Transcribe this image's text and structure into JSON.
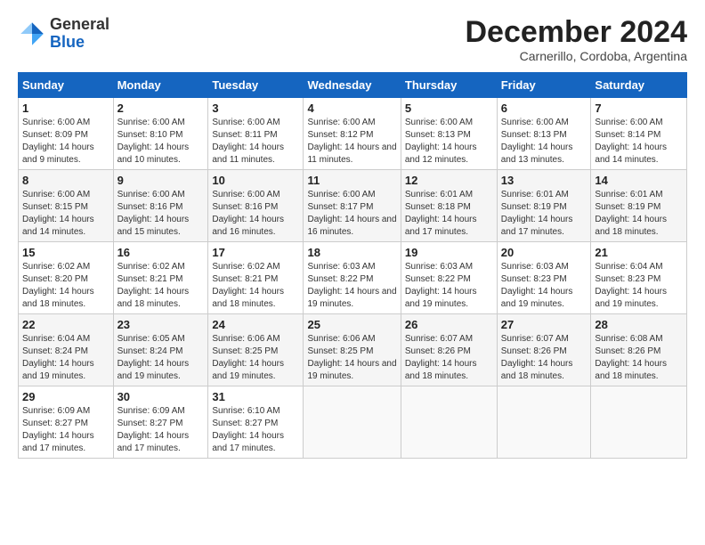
{
  "logo": {
    "general": "General",
    "blue": "Blue"
  },
  "title": "December 2024",
  "subtitle": "Carnerillo, Cordoba, Argentina",
  "days_header": [
    "Sunday",
    "Monday",
    "Tuesday",
    "Wednesday",
    "Thursday",
    "Friday",
    "Saturday"
  ],
  "weeks": [
    [
      {
        "day": "1",
        "sunrise": "6:00 AM",
        "sunset": "8:09 PM",
        "daylight": "14 hours and 9 minutes."
      },
      {
        "day": "2",
        "sunrise": "6:00 AM",
        "sunset": "8:10 PM",
        "daylight": "14 hours and 10 minutes."
      },
      {
        "day": "3",
        "sunrise": "6:00 AM",
        "sunset": "8:11 PM",
        "daylight": "14 hours and 11 minutes."
      },
      {
        "day": "4",
        "sunrise": "6:00 AM",
        "sunset": "8:12 PM",
        "daylight": "14 hours and 11 minutes."
      },
      {
        "day": "5",
        "sunrise": "6:00 AM",
        "sunset": "8:13 PM",
        "daylight": "14 hours and 12 minutes."
      },
      {
        "day": "6",
        "sunrise": "6:00 AM",
        "sunset": "8:13 PM",
        "daylight": "14 hours and 13 minutes."
      },
      {
        "day": "7",
        "sunrise": "6:00 AM",
        "sunset": "8:14 PM",
        "daylight": "14 hours and 14 minutes."
      }
    ],
    [
      {
        "day": "8",
        "sunrise": "6:00 AM",
        "sunset": "8:15 PM",
        "daylight": "14 hours and 14 minutes."
      },
      {
        "day": "9",
        "sunrise": "6:00 AM",
        "sunset": "8:16 PM",
        "daylight": "14 hours and 15 minutes."
      },
      {
        "day": "10",
        "sunrise": "6:00 AM",
        "sunset": "8:16 PM",
        "daylight": "14 hours and 16 minutes."
      },
      {
        "day": "11",
        "sunrise": "6:00 AM",
        "sunset": "8:17 PM",
        "daylight": "14 hours and 16 minutes."
      },
      {
        "day": "12",
        "sunrise": "6:01 AM",
        "sunset": "8:18 PM",
        "daylight": "14 hours and 17 minutes."
      },
      {
        "day": "13",
        "sunrise": "6:01 AM",
        "sunset": "8:19 PM",
        "daylight": "14 hours and 17 minutes."
      },
      {
        "day": "14",
        "sunrise": "6:01 AM",
        "sunset": "8:19 PM",
        "daylight": "14 hours and 18 minutes."
      }
    ],
    [
      {
        "day": "15",
        "sunrise": "6:02 AM",
        "sunset": "8:20 PM",
        "daylight": "14 hours and 18 minutes."
      },
      {
        "day": "16",
        "sunrise": "6:02 AM",
        "sunset": "8:21 PM",
        "daylight": "14 hours and 18 minutes."
      },
      {
        "day": "17",
        "sunrise": "6:02 AM",
        "sunset": "8:21 PM",
        "daylight": "14 hours and 18 minutes."
      },
      {
        "day": "18",
        "sunrise": "6:03 AM",
        "sunset": "8:22 PM",
        "daylight": "14 hours and 19 minutes."
      },
      {
        "day": "19",
        "sunrise": "6:03 AM",
        "sunset": "8:22 PM",
        "daylight": "14 hours and 19 minutes."
      },
      {
        "day": "20",
        "sunrise": "6:03 AM",
        "sunset": "8:23 PM",
        "daylight": "14 hours and 19 minutes."
      },
      {
        "day": "21",
        "sunrise": "6:04 AM",
        "sunset": "8:23 PM",
        "daylight": "14 hours and 19 minutes."
      }
    ],
    [
      {
        "day": "22",
        "sunrise": "6:04 AM",
        "sunset": "8:24 PM",
        "daylight": "14 hours and 19 minutes."
      },
      {
        "day": "23",
        "sunrise": "6:05 AM",
        "sunset": "8:24 PM",
        "daylight": "14 hours and 19 minutes."
      },
      {
        "day": "24",
        "sunrise": "6:06 AM",
        "sunset": "8:25 PM",
        "daylight": "14 hours and 19 minutes."
      },
      {
        "day": "25",
        "sunrise": "6:06 AM",
        "sunset": "8:25 PM",
        "daylight": "14 hours and 19 minutes."
      },
      {
        "day": "26",
        "sunrise": "6:07 AM",
        "sunset": "8:26 PM",
        "daylight": "14 hours and 18 minutes."
      },
      {
        "day": "27",
        "sunrise": "6:07 AM",
        "sunset": "8:26 PM",
        "daylight": "14 hours and 18 minutes."
      },
      {
        "day": "28",
        "sunrise": "6:08 AM",
        "sunset": "8:26 PM",
        "daylight": "14 hours and 18 minutes."
      }
    ],
    [
      {
        "day": "29",
        "sunrise": "6:09 AM",
        "sunset": "8:27 PM",
        "daylight": "14 hours and 17 minutes."
      },
      {
        "day": "30",
        "sunrise": "6:09 AM",
        "sunset": "8:27 PM",
        "daylight": "14 hours and 17 minutes."
      },
      {
        "day": "31",
        "sunrise": "6:10 AM",
        "sunset": "8:27 PM",
        "daylight": "14 hours and 17 minutes."
      },
      null,
      null,
      null,
      null
    ]
  ]
}
